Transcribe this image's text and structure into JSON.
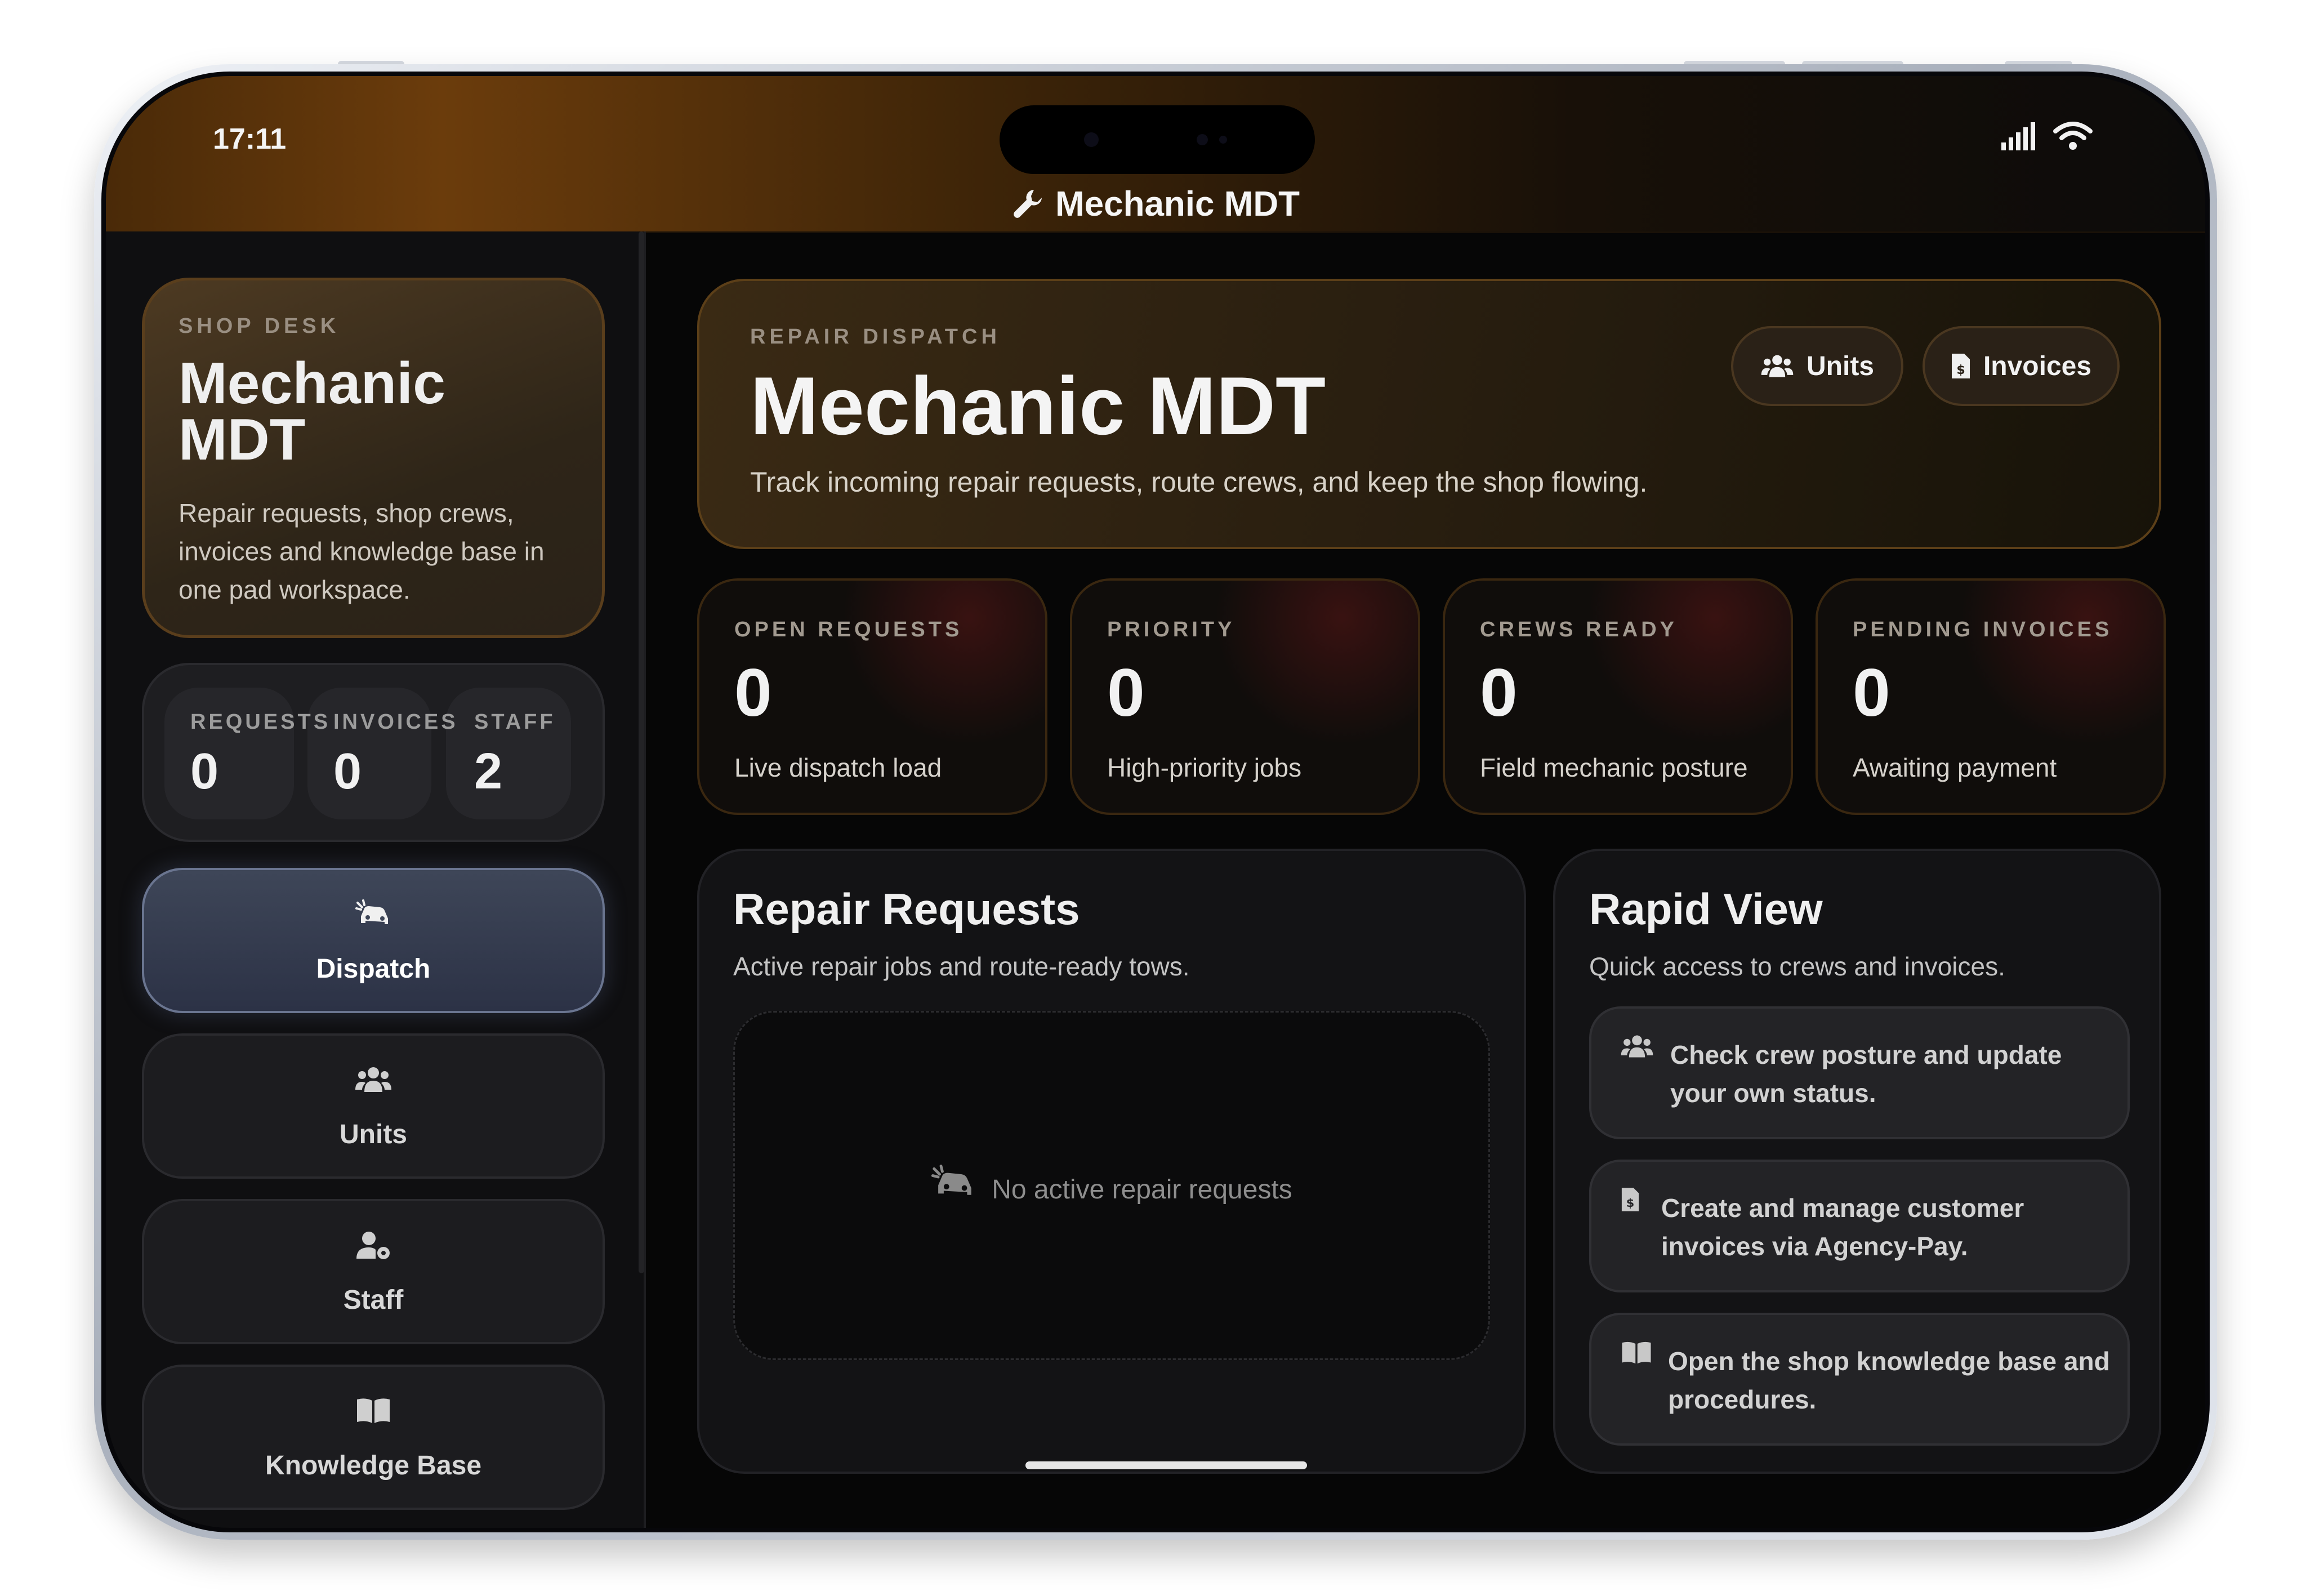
{
  "status_bar": {
    "time": "17:11",
    "icons": [
      "signal-icon",
      "wifi-icon"
    ]
  },
  "header": {
    "title": "Mechanic MDT",
    "icon": "wrench-icon"
  },
  "sidebar": {
    "hero": {
      "eyebrow": "SHOP DESK",
      "title_line1": "Mechanic",
      "title_line2": "MDT",
      "description": "Repair requests, shop crews, invoices and knowledge base in one pad workspace."
    },
    "counts": [
      {
        "label": "REQUESTS",
        "value": "0"
      },
      {
        "label": "INVOICES",
        "value": "0"
      },
      {
        "label": "STAFF",
        "value": "2"
      }
    ],
    "nav": [
      {
        "label": "Dispatch",
        "icon": "car-crash-icon",
        "active": true
      },
      {
        "label": "Units",
        "icon": "users-icon",
        "active": false
      },
      {
        "label": "Staff",
        "icon": "user-gear-icon",
        "active": false
      },
      {
        "label": "Knowledge Base",
        "icon": "book-icon",
        "active": false
      }
    ]
  },
  "dispatch_hero": {
    "eyebrow": "REPAIR DISPATCH",
    "title": "Mechanic MDT",
    "subtitle": "Track incoming repair requests, route crews, and keep the shop flowing.",
    "buttons": [
      {
        "label": "Units",
        "icon": "users-icon"
      },
      {
        "label": "Invoices",
        "icon": "invoice-icon"
      }
    ]
  },
  "stats": [
    {
      "label": "OPEN REQUESTS",
      "value": "0",
      "sub": "Live dispatch load"
    },
    {
      "label": "PRIORITY",
      "value": "0",
      "sub": "High-priority jobs"
    },
    {
      "label": "CREWS READY",
      "value": "0",
      "sub": "Field mechanic posture"
    },
    {
      "label": "PENDING INVOICES",
      "value": "0",
      "sub": "Awaiting payment"
    }
  ],
  "repair_requests": {
    "title": "Repair Requests",
    "subtitle": "Active repair jobs and route-ready tows.",
    "empty_text": "No active repair requests"
  },
  "rapid_view": {
    "title": "Rapid View",
    "subtitle": "Quick access to crews and invoices.",
    "items": [
      {
        "text": "Check crew posture and update your own status.",
        "icon": "users-icon"
      },
      {
        "text": "Create and manage customer invoices via Agency-Pay.",
        "icon": "invoice-icon"
      },
      {
        "text": "Open the shop knowledge base and procedures.",
        "icon": "book-icon"
      }
    ]
  },
  "colors": {
    "accent_brown": "#6b3c0c",
    "active_nav": "#3e4658",
    "panel": "#131315"
  }
}
